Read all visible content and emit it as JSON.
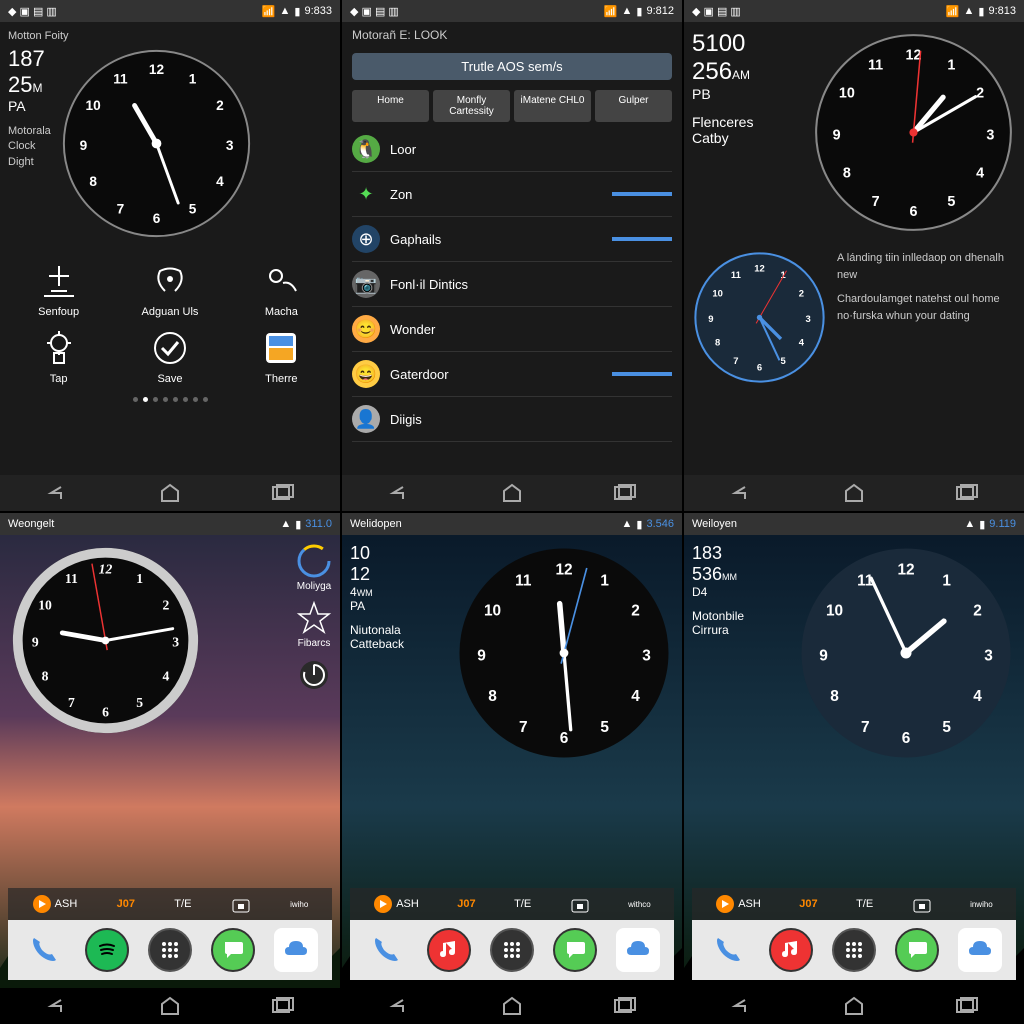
{
  "p1": {
    "status_time": "9:833",
    "title": "Motton Foity",
    "num1": "187",
    "num2": "25",
    "num2_unit": "M",
    "pa": "PA",
    "info1": "Motorala",
    "info2": "Clock",
    "info3": "Dight",
    "apps": [
      {
        "label": "Senfoup"
      },
      {
        "label": "Adguan Uls"
      },
      {
        "label": "Macha"
      },
      {
        "label": "Tap"
      },
      {
        "label": "Save"
      },
      {
        "label": "Therre"
      }
    ]
  },
  "p2": {
    "status_time": "9:812",
    "title": "Motorañ E: LOOK",
    "subtitle": "Trutle AOS sem/s",
    "tabs": [
      "Home",
      "Monfly Cartessity",
      "iMatene CHL0",
      "Gulper"
    ],
    "items": [
      "Loor",
      "Zon",
      "Gaphails",
      "Fonl·il Dintics",
      "Wonder",
      "Gaterdoor",
      "Diigis"
    ]
  },
  "p3": {
    "status_time": "9:813",
    "num1": "5100",
    "num2": "256",
    "num2_unit": "AM",
    "pb": "PB",
    "info1": "Flenceres",
    "info2": "Catby",
    "text1": "A lánding tiin inlledaop on dhenalh new",
    "text2": "Chardoulamget natehst oul home no·furska whun your dating"
  },
  "p4": {
    "status_time": "311.0",
    "title": "Weongelt",
    "side": [
      "Moliyga",
      "Fibarcs"
    ],
    "quick": [
      "ASH",
      "J07",
      "T/E"
    ],
    "iwtho": "iwiho"
  },
  "p5": {
    "status_time": "3.546",
    "title": "Welidopen",
    "num1": "10",
    "num2": "12",
    "num3": "4",
    "num3_unit": "WM",
    "pa": "PA",
    "info1": "Niutonala",
    "info2": "Catteback",
    "quick": [
      "ASH",
      "J07",
      "T/E"
    ],
    "withco": "withco"
  },
  "p6": {
    "status_time": "9.119",
    "title": "Weiloyen",
    "num1": "183",
    "num2": "536",
    "num2_unit": "MM",
    "d4": "D4",
    "info1": "Motonbile",
    "info2": "Cirrura",
    "quick": [
      "ASH",
      "J07",
      "T/E"
    ],
    "inwiho": "inwiho"
  }
}
